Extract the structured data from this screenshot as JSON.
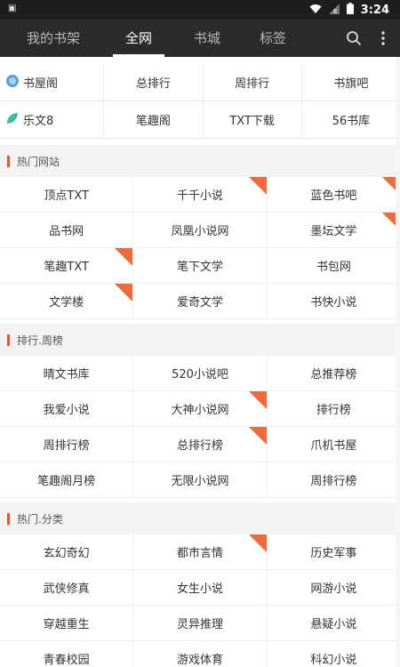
{
  "status_bar": {
    "time": "3:24",
    "left_icon": "sim-card-icon",
    "icons": [
      "wifi-icon",
      "signal-icon",
      "battery-icon"
    ]
  },
  "top_nav": {
    "tabs": [
      {
        "label": "我的书架",
        "active": false
      },
      {
        "label": "全网",
        "active": true
      },
      {
        "label": "书城",
        "active": false
      },
      {
        "label": "标签",
        "active": false
      }
    ],
    "icons": [
      "search-icon",
      "more-vertical-icon"
    ]
  },
  "quick_rows": [
    [
      {
        "label": "书屋阁",
        "icon": "globe-icon"
      },
      {
        "label": "总排行"
      },
      {
        "label": "周排行"
      },
      {
        "label": "书旗吧"
      }
    ],
    [
      {
        "label": "乐文8",
        "icon": "leaf-icon"
      },
      {
        "label": "笔趣阁"
      },
      {
        "label": "TXT下载"
      },
      {
        "label": "56书库"
      }
    ]
  ],
  "sections": [
    {
      "title": "热门网站",
      "rows": [
        [
          {
            "label": "顶点TXT"
          },
          {
            "label": "千千小说",
            "hot": true
          },
          {
            "label": "蓝色书吧",
            "hot": true
          }
        ],
        [
          {
            "label": "品书网"
          },
          {
            "label": "凤凰小说网"
          },
          {
            "label": "墨坛文学",
            "hot": true
          }
        ],
        [
          {
            "label": "笔趣TXT",
            "hot": true
          },
          {
            "label": "笔下文学"
          },
          {
            "label": "书包网"
          }
        ],
        [
          {
            "label": "文学楼",
            "hot": true
          },
          {
            "label": "爱奇文学"
          },
          {
            "label": "书快小说"
          }
        ]
      ]
    },
    {
      "title": "排行.周榜",
      "rows": [
        [
          {
            "label": "晴文书库"
          },
          {
            "label": "520小说吧"
          },
          {
            "label": "总推荐榜"
          }
        ],
        [
          {
            "label": "我爱小说"
          },
          {
            "label": "大神小说网",
            "hot": true
          },
          {
            "label": "排行榜"
          }
        ],
        [
          {
            "label": "周排行榜"
          },
          {
            "label": "总排行榜",
            "hot": true
          },
          {
            "label": "爪机书屋"
          }
        ],
        [
          {
            "label": "笔趣阁月榜"
          },
          {
            "label": "无限小说网"
          },
          {
            "label": "周排行榜"
          }
        ]
      ]
    },
    {
      "title": "热门.分类",
      "rows": [
        [
          {
            "label": "玄幻奇幻"
          },
          {
            "label": "都市言情",
            "hot": true
          },
          {
            "label": "历史军事"
          }
        ],
        [
          {
            "label": "武侠修真"
          },
          {
            "label": "女生小说"
          },
          {
            "label": "网游小说"
          }
        ],
        [
          {
            "label": "穿越重生"
          },
          {
            "label": "灵异推理"
          },
          {
            "label": "悬疑小说"
          }
        ],
        [
          {
            "label": "青春校园"
          },
          {
            "label": "游戏体育"
          },
          {
            "label": "科幻小说"
          }
        ]
      ]
    }
  ],
  "colors": {
    "nav_bg": "#2b2b2b",
    "status_bg": "#1e1e1e",
    "accent": "#e5542f",
    "hot_corner": "#ef6a3f"
  }
}
